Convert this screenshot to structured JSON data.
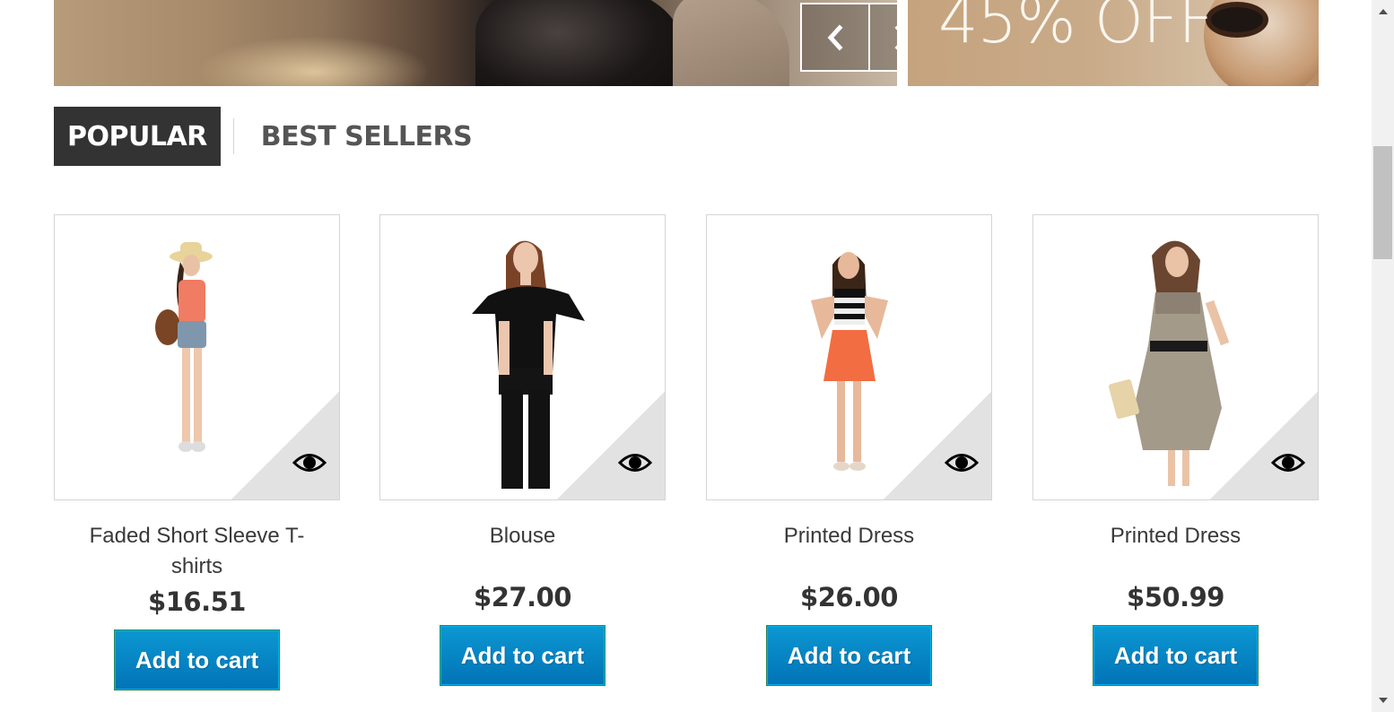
{
  "banner": {
    "side_promo_text": "45% OFF",
    "prev_icon": "chevron-left-icon",
    "next_icon": "chevron-right-icon"
  },
  "tabs": [
    {
      "label": "POPULAR",
      "active": true
    },
    {
      "label": "BEST SELLERS",
      "active": false
    }
  ],
  "products": [
    {
      "name": "Faded Short Sleeve T-shirts",
      "price": "$16.51",
      "button": "Add to cart",
      "quick_view_icon": "eye-icon"
    },
    {
      "name": "Blouse",
      "price": "$27.00",
      "button": "Add to cart",
      "quick_view_icon": "eye-icon"
    },
    {
      "name": "Printed Dress",
      "price": "$26.00",
      "button": "Add to cart",
      "quick_view_icon": "eye-icon"
    },
    {
      "name": "Printed Dress",
      "price": "$50.99",
      "button": "Add to cart",
      "quick_view_icon": "eye-icon"
    }
  ],
  "colors": {
    "tab_active_bg": "#333333",
    "button_top": "#0b97d2",
    "button_bottom": "#0274b6"
  }
}
